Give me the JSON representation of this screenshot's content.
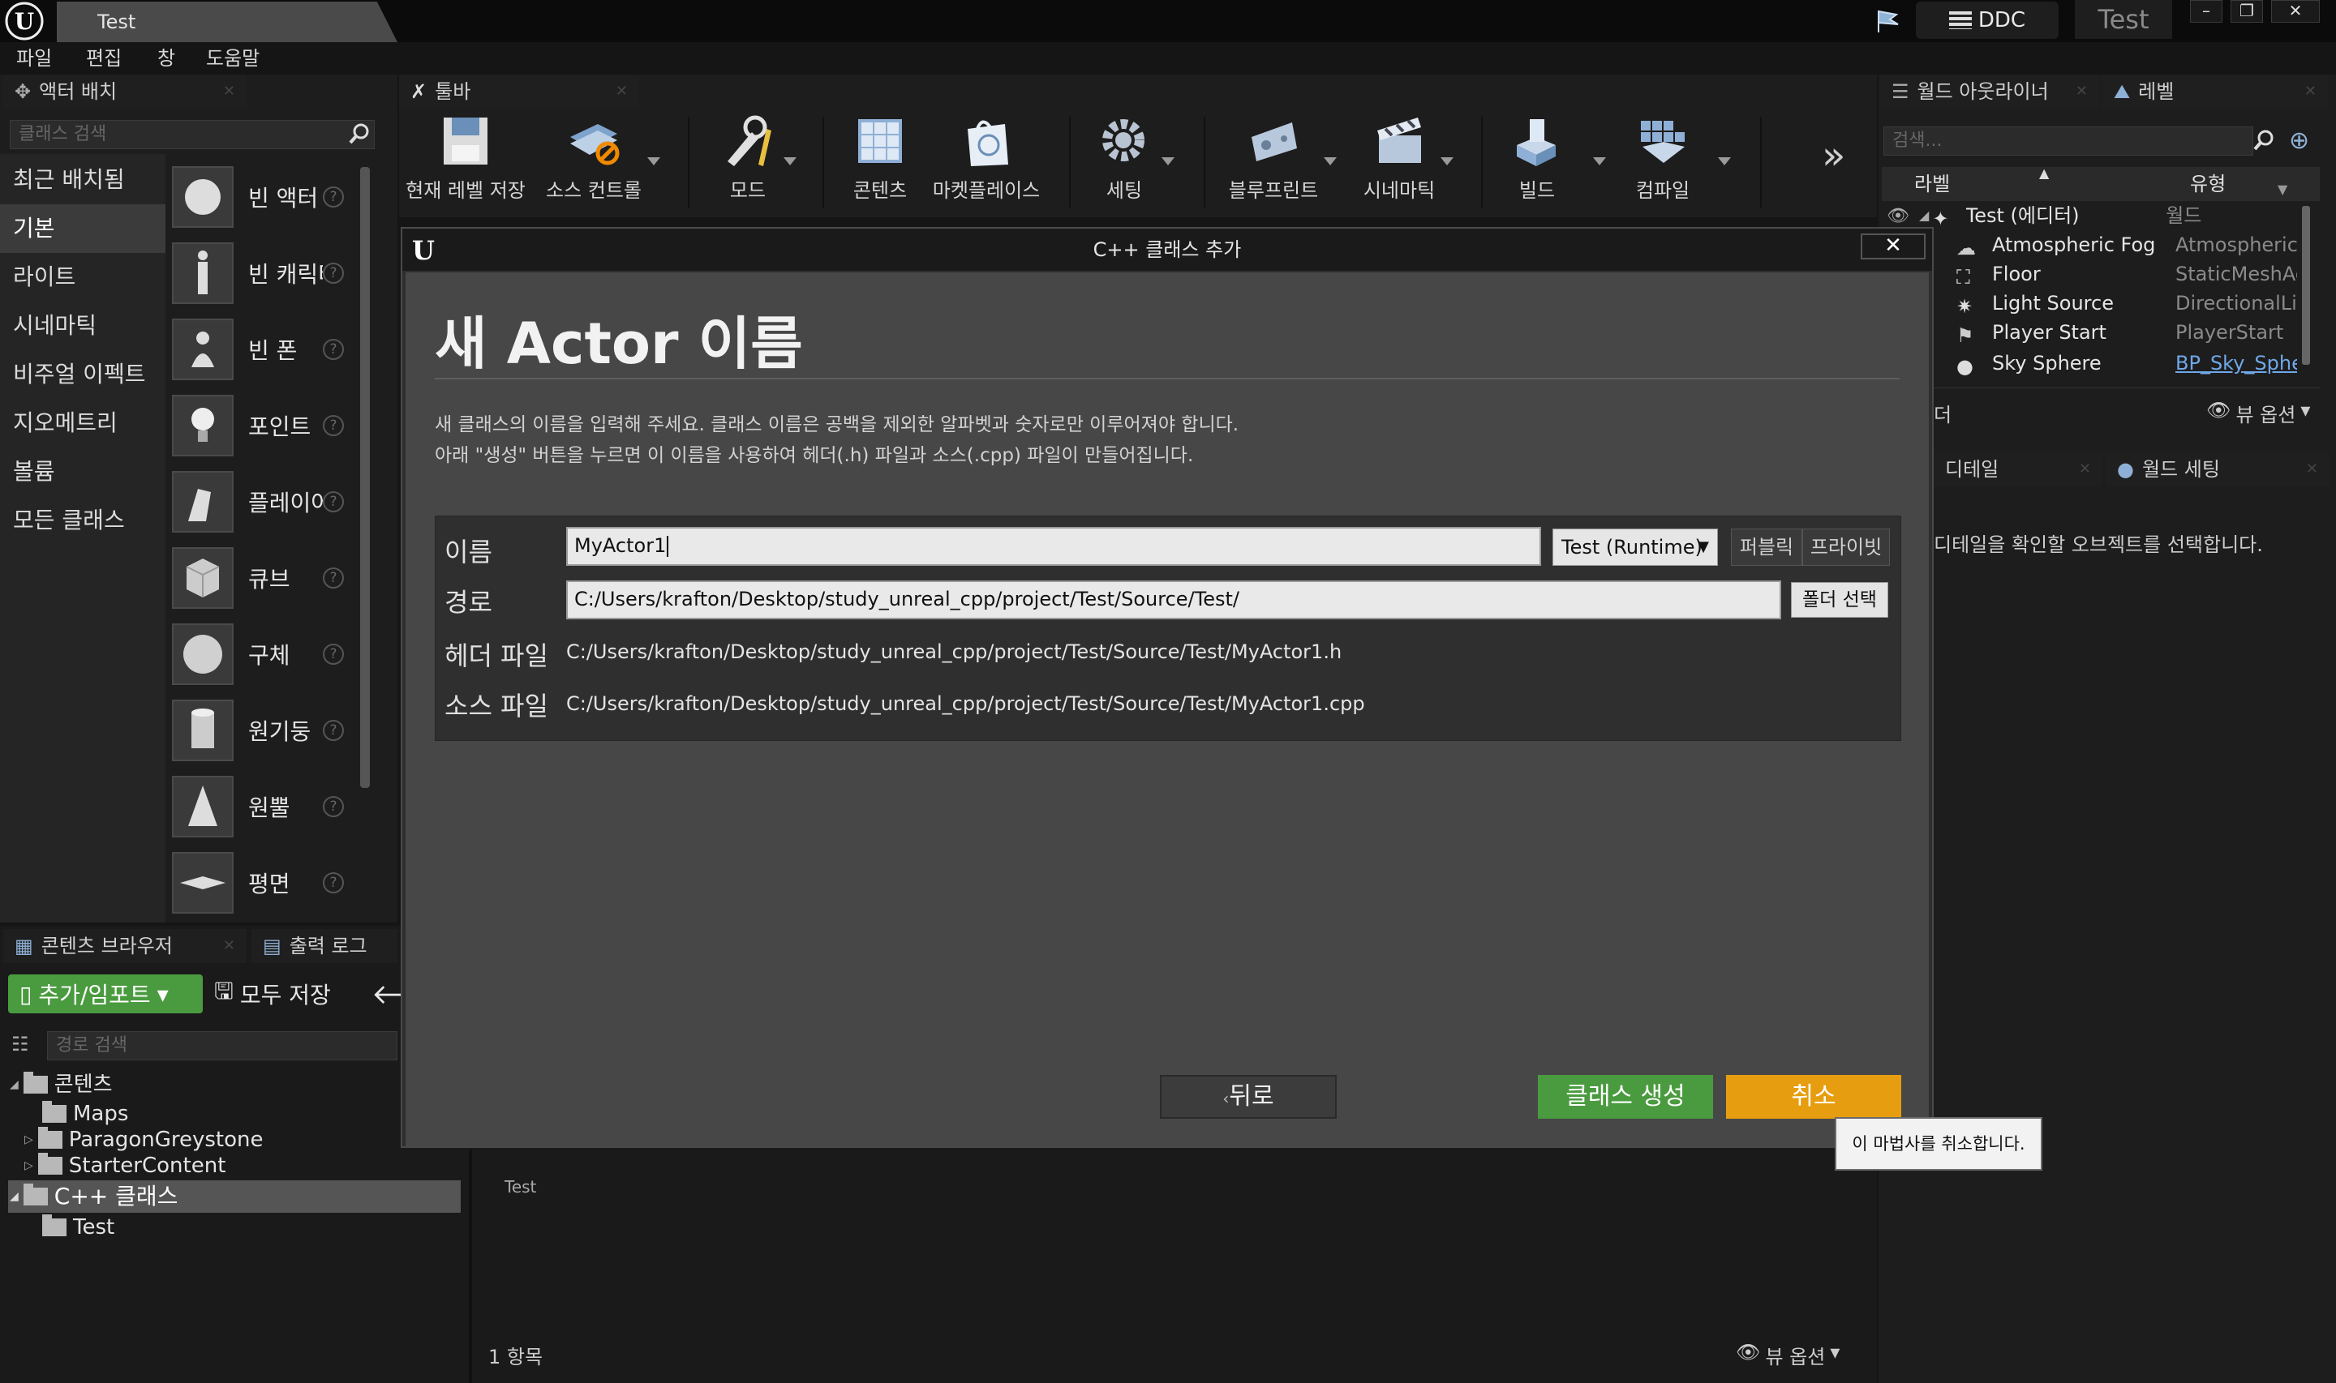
{
  "window": {
    "tab_title": "Test",
    "ddc_label": "DDC",
    "project_name": "Test"
  },
  "menu": [
    "파일",
    "편집",
    "창",
    "도움말"
  ],
  "place_actors": {
    "tab_label": "액터 배치",
    "search_placeholder": "클래스 검색",
    "categories": [
      "최근 배치됨",
      "기본",
      "라이트",
      "시네마틱",
      "비주얼 이펙트",
      "지오메트리",
      "볼륨",
      "모든 클래스"
    ],
    "selected_category": "기본",
    "items": [
      "빈 액터",
      "빈 캐릭터",
      "빈 폰",
      "포인트",
      "플레이어",
      "큐브",
      "구체",
      "원기둥",
      "원뿔",
      "평면"
    ]
  },
  "toolbar": {
    "tab_label": "툴바",
    "buttons": [
      "현재 레벨 저장",
      "소스 컨트롤",
      "모드",
      "콘텐츠",
      "마켓플레이스",
      "세팅",
      "블루프린트",
      "시네마틱",
      "빌드",
      "컴파일"
    ],
    "more": "»"
  },
  "outliner": {
    "tab_label": "월드 아웃라이너",
    "tab2_label": "레벨",
    "search_placeholder": "검색...",
    "col_label": "라벨",
    "col_type": "유형",
    "rows": [
      {
        "label": "Test (에디터)",
        "type": "월드"
      },
      {
        "label": "Atmospheric Fog",
        "type": "AtmosphericFog"
      },
      {
        "label": "Floor",
        "type": "StaticMeshActor"
      },
      {
        "label": "Light Source",
        "type": "DirectionalLight"
      },
      {
        "label": "Player Start",
        "type": "PlayerStart"
      },
      {
        "label": "Sky Sphere",
        "type": "BP_Sky_Sphere"
      }
    ],
    "count_partial": "더",
    "view_options": "뷰 옵션"
  },
  "details": {
    "tab_label": "디테일",
    "tab2_label": "월드 세팅",
    "hint": "디테일을 확인할 오브젝트를 선택합니다."
  },
  "content_browser": {
    "tab_label": "콘텐츠 브라우저",
    "tab2_label": "출력 로그",
    "add_import": "추가/임포트",
    "save_all": "모두 저장",
    "search_placeholder": "경로 검색",
    "tree": [
      "콘텐츠",
      "Maps",
      "ParagonGreystone",
      "StarterContent",
      "C++ 클래스",
      "Test"
    ],
    "asset_label": "Test",
    "item_count": "1 항목",
    "view_options": "뷰 옵션"
  },
  "dialog": {
    "title": "C++ 클래스 추가",
    "close": "✕",
    "heading": "새 Actor 이름",
    "desc1": "새 클래스의 이름을 입력해 주세요. 클래스 이름은 공백을 제외한 알파벳과 숫자로만 이루어져야 합니다.",
    "desc2": "아래 \"생성\" 버튼을 누르면 이 이름을 사용하여 헤더(.h) 파일과 소스(.cpp) 파일이 만들어집니다.",
    "name_label": "이름",
    "name_value": "MyActor1",
    "module": "Test (Runtime)",
    "public_btn": "퍼블릭",
    "private_btn": "프라이빗",
    "path_label": "경로",
    "path_value": "C:/Users/krafton/Desktop/study_unreal_cpp/project/Test/Source/Test/",
    "folder_btn": "폴더 선택",
    "header_label": "헤더 파일",
    "header_value": "C:/Users/krafton/Desktop/study_unreal_cpp/project/Test/Source/Test/MyActor1.h",
    "source_label": "소스 파일",
    "source_value": "C:/Users/krafton/Desktop/study_unreal_cpp/project/Test/Source/Test/MyActor1.cpp",
    "back_btn": "뒤로",
    "create_btn": "클래스 생성",
    "cancel_btn": "취소",
    "tooltip": "이 마법사를 취소합니다."
  }
}
